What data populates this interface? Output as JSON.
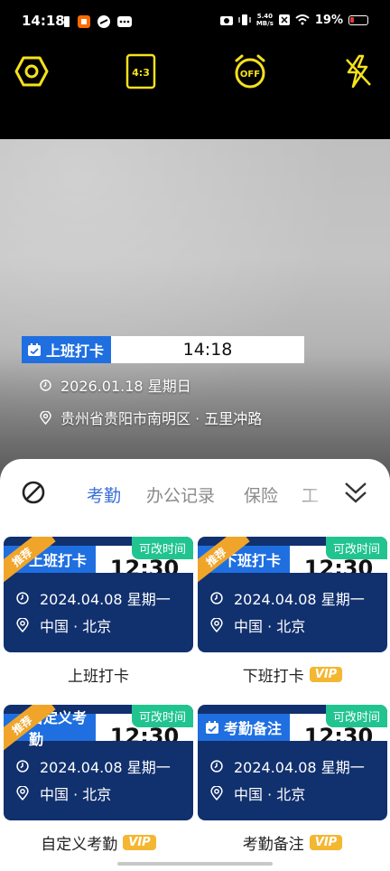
{
  "status_bar": {
    "time": "14:18",
    "net_speed_value": "5.40",
    "net_speed_unit": "MB/s",
    "battery": "19%"
  },
  "toolbar": {
    "icons": [
      "settings-hex-icon",
      "aspect-ratio-icon",
      "timer-off-icon",
      "flash-auto-icon"
    ],
    "aspect_ratio": "4:3",
    "timer": "OFF",
    "accent_color": "#f7e11b"
  },
  "watermark": {
    "tag": "上班打卡",
    "time": "14:18",
    "date": "2026.01.18 星期日",
    "location": "贵州省贵阳市南明区 · 五里冲路"
  },
  "tabs": {
    "items": [
      "考勤",
      "办公记录",
      "保险",
      "工"
    ],
    "active": "考勤"
  },
  "cards": [
    {
      "tag": "上班打卡",
      "time": "12:30",
      "editable": "可改时间",
      "ribbon": "推荐",
      "date": "2024.04.08   星期一",
      "location": "中国 · 北京",
      "title": "上班打卡",
      "vip": ""
    },
    {
      "tag": "下班打卡",
      "time": "12:30",
      "editable": "可改时间",
      "ribbon": "推荐",
      "date": "2024.04.08   星期一",
      "location": "中国 · 北京",
      "title": "下班打卡",
      "vip": "VIP"
    },
    {
      "tag": "自定义考勤",
      "time": "12:30",
      "editable": "可改时间",
      "ribbon": "推荐",
      "date": "2024.04.08   星期一",
      "location": "中国 · 北京",
      "title": "自定义考勤",
      "vip": "VIP"
    },
    {
      "tag": "考勤备注",
      "time": "12:30",
      "editable": "可改时间",
      "ribbon": "",
      "date": "2024.04.08   星期一",
      "location": "中国 · 北京",
      "title": "考勤备注",
      "vip": "VIP"
    }
  ]
}
